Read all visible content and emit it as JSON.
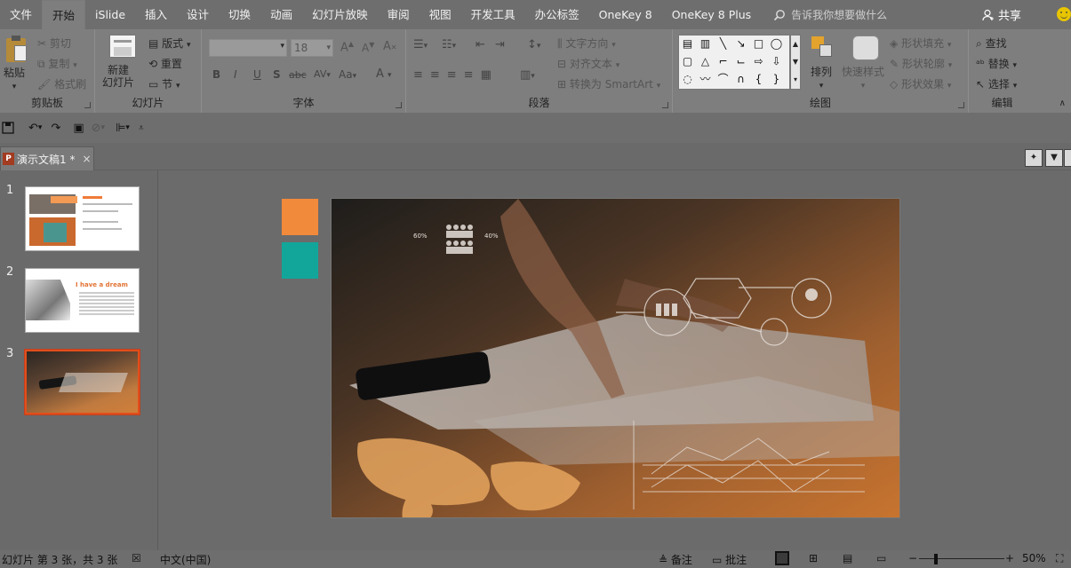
{
  "menu": {
    "tabs": [
      "文件",
      "开始",
      "iSlide",
      "插入",
      "设计",
      "切换",
      "动画",
      "幻灯片放映",
      "审阅",
      "视图",
      "开发工具",
      "办公标签",
      "OneKey 8",
      "OneKey 8 Plus"
    ],
    "active_tab": "开始",
    "tellme_placeholder": "告诉我你想要做什么",
    "share_label": "共享"
  },
  "ribbon": {
    "clipboard": {
      "label": "剪贴板",
      "paste": "粘贴",
      "cut": "剪切",
      "copy": "复制",
      "format_painter": "格式刷"
    },
    "slides": {
      "label": "幻灯片",
      "new_slide": "新建\n幻灯片",
      "layout": "版式",
      "reset": "重置",
      "section": "节"
    },
    "font": {
      "label": "字体",
      "font_size": "18",
      "bold": "B",
      "italic": "I",
      "underline": "U",
      "shadow": "S",
      "strike": "abc",
      "spacing": "AV",
      "case": "Aa",
      "color": "A",
      "grow": "A",
      "shrink": "A",
      "clear": "A"
    },
    "paragraph": {
      "label": "段落",
      "text_direction": "文字方向",
      "align_text": "对齐文本",
      "smartart": "转换为 SmartArt"
    },
    "drawing": {
      "label": "绘图",
      "arrange": "排列",
      "quick_styles": "快速样式",
      "shape_fill": "形状填充",
      "shape_outline": "形状轮廓",
      "shape_effects": "形状效果"
    },
    "editing": {
      "label": "编辑",
      "find": "查找",
      "replace": "替换",
      "select": "选择"
    }
  },
  "document": {
    "tab_title": "演示文稿1 *"
  },
  "thumbnails": [
    {
      "number": "1",
      "selected": false
    },
    {
      "number": "2",
      "selected": false,
      "heading": "I have a dream"
    },
    {
      "number": "3",
      "selected": true
    }
  ],
  "slide": {
    "accent_orange": "#f28a3b",
    "accent_teal": "#12a69a",
    "stat_left": "60%",
    "stat_right": "40%"
  },
  "status": {
    "slide_info": "幻灯片 第 3 张，共 3 张",
    "language": "中文(中国)",
    "notes": "备注",
    "comments": "批注",
    "zoom": "50%"
  }
}
